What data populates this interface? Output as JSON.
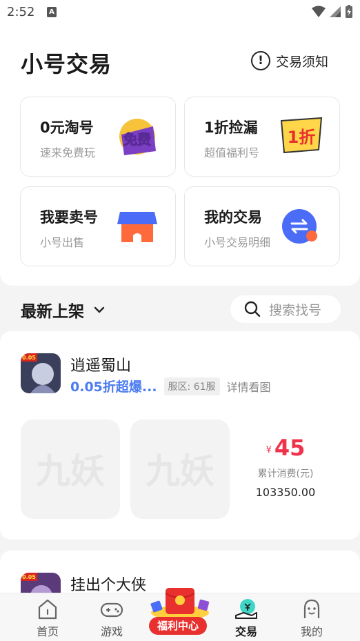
{
  "status_bar": {
    "time": "2:52",
    "a_icon": "A"
  },
  "header": {
    "title": "小号交易",
    "notice_icon_glyph": "!",
    "notice_label": "交易须知"
  },
  "cards": [
    {
      "title": "0元淘号",
      "subtitle": "速来免费玩",
      "art_text": "免费"
    },
    {
      "title": "1折捡漏",
      "subtitle": "超值福利号",
      "art_text": "1折"
    },
    {
      "title": "我要卖号",
      "subtitle": "小号出售"
    },
    {
      "title": "我的交易",
      "subtitle": "小号交易明细"
    }
  ],
  "section": {
    "title": "最新上架",
    "search_placeholder": "搜索找号"
  },
  "listings": [
    {
      "game_name": "逍遥蜀山",
      "discount": "0.05折超爆...",
      "server_tag": "服区: 61服",
      "detail": "详情看图",
      "icon_badge": "0.05",
      "thumb_watermark": "九妖",
      "currency": "¥",
      "price": "45",
      "spend_label": "累计消费(元)",
      "spend_value": "103350.00"
    },
    {
      "game_name": "挂出个大侠",
      "icon_badge": "0.05"
    }
  ],
  "tabbar": {
    "tabs": [
      {
        "label": "首页"
      },
      {
        "label": "游戏"
      },
      {
        "label": "交易"
      },
      {
        "label": "我的"
      }
    ],
    "welfare_label": "福利中心"
  },
  "colors": {
    "price_red": "#f0334b",
    "discount_blue": "#4c7cf0",
    "welfare_red": "#e8312e",
    "accent_orange": "#ff6a3d",
    "accent_blue": "#4a6cf7"
  }
}
